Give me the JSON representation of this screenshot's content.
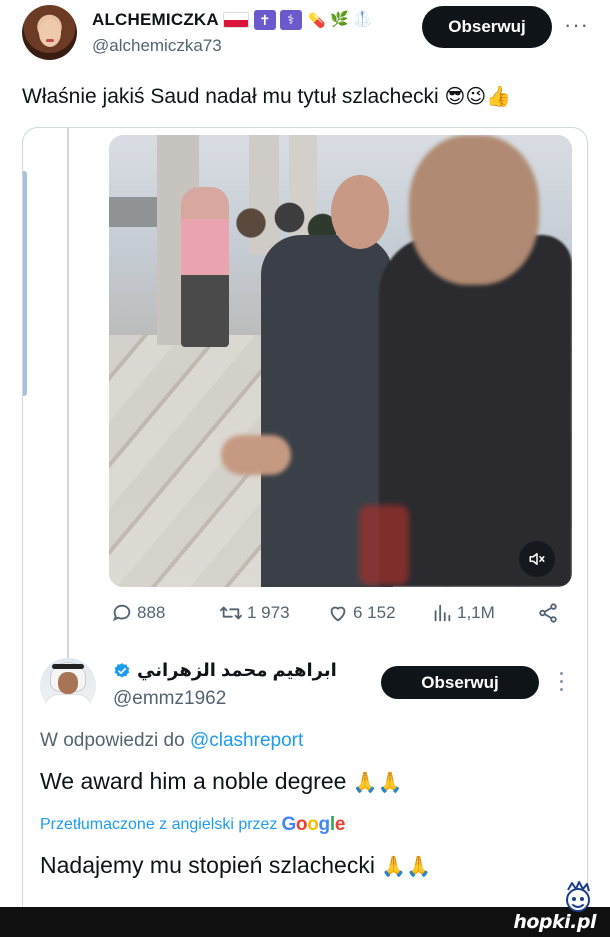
{
  "main_tweet": {
    "display_name": "ALCHEMICZKA",
    "name_emojis": [
      "flag-poland",
      "latin-cross",
      "caduceus",
      "pill",
      "herb",
      "lab-coat"
    ],
    "handle": "@alchemiczka73",
    "follow_label": "Obserwuj",
    "more_label": "···",
    "text": "Właśnie jakiś Saud nadał mu tytuł szlachecki",
    "text_emojis": "😎😉👍"
  },
  "quoted_tweet": {
    "video": {
      "mute_icon": "speaker-muted-icon"
    },
    "stats": {
      "replies": "888",
      "retweets": "1 973",
      "likes": "6 152",
      "views": "1,1M"
    },
    "reply": {
      "display_name": "ابراهيم محمد الزهراني",
      "verified": true,
      "handle": "@emmz1962",
      "follow_label": "Obserwuj",
      "reply_to_prefix": "W odpowiedzi do",
      "reply_to_mention": "@clashreport",
      "text": "We award him a noble degree",
      "text_emojis": "🙏🙏",
      "translated_prefix": "Przetłumaczone z angielski przez",
      "translated_brand": "Google",
      "translated_text": "Nadajemy mu stopień szlachecki",
      "translated_emojis": "🙏🙏"
    }
  },
  "watermark": {
    "site": "hopki.pl"
  },
  "colors": {
    "link_blue": "#1d9bf0",
    "text_primary": "#0f1419",
    "text_secondary": "#536471",
    "button_dark": "#0f1419",
    "border": "#cfd9de"
  }
}
